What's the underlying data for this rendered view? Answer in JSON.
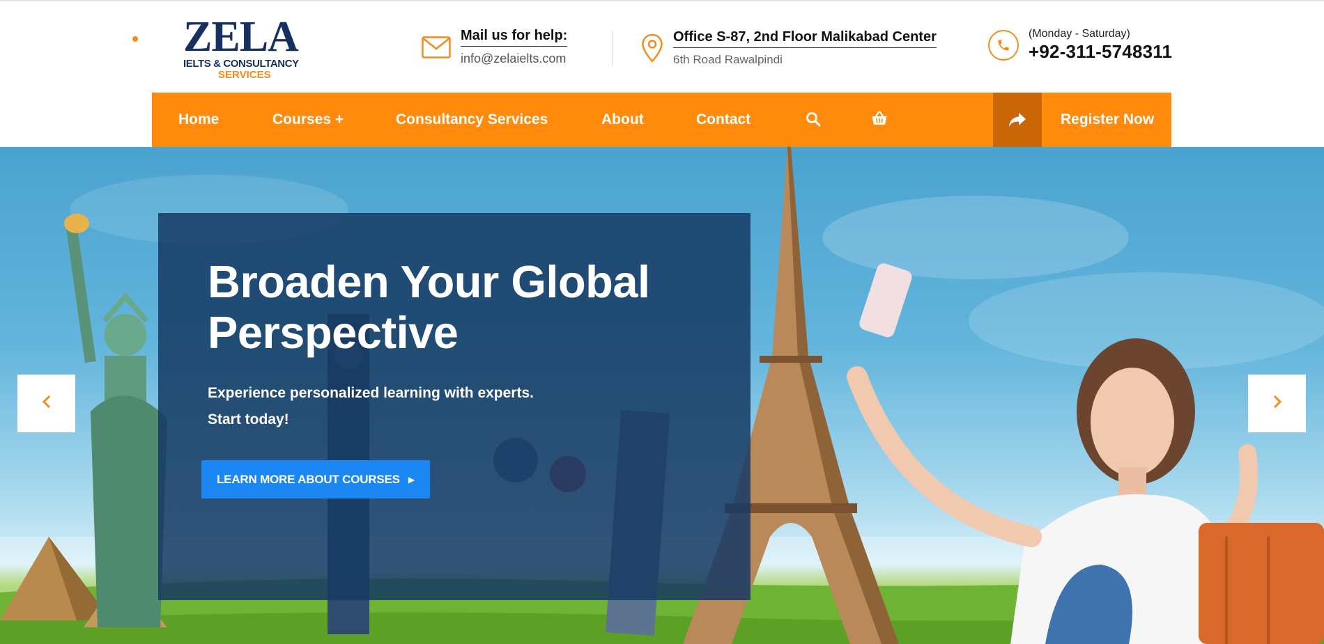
{
  "logo": {
    "main": "ZELA",
    "line1": "IELTS & CONSULTANCY",
    "line2": "SERVICES"
  },
  "contact": {
    "mail_title": "Mail us for help:",
    "mail_value": "info@zelaielts.com",
    "office_title": "Office S-87, 2nd Floor Malikabad Center",
    "office_value": "6th Road Rawalpindi",
    "phone_days": "(Monday - Saturday)",
    "phone_number": "+92-311-5748311"
  },
  "nav": {
    "home": "Home",
    "courses": "Courses +",
    "consultancy": "Consultancy Services",
    "about": "About",
    "contact": "Contact",
    "register": "Register Now"
  },
  "hero": {
    "headline_line1": "Broaden Your Global",
    "headline_line2": "Perspective",
    "sub_line1": "Experience personalized learning with experts.",
    "sub_line2": "Start today!",
    "cta": "LEARN MORE ABOUT COURSES"
  },
  "icons": {
    "mail": "envelope-icon",
    "office": "map-pin-icon",
    "phone": "phone-icon",
    "search": "search-icon",
    "cart": "basket-icon",
    "register": "share-arrow-icon",
    "prev": "chevron-left-icon",
    "next": "chevron-right-icon"
  },
  "colors": {
    "accent": "#ff8a0c",
    "navy": "#16305f",
    "button": "#1a87f2",
    "panel": "#163a63"
  }
}
